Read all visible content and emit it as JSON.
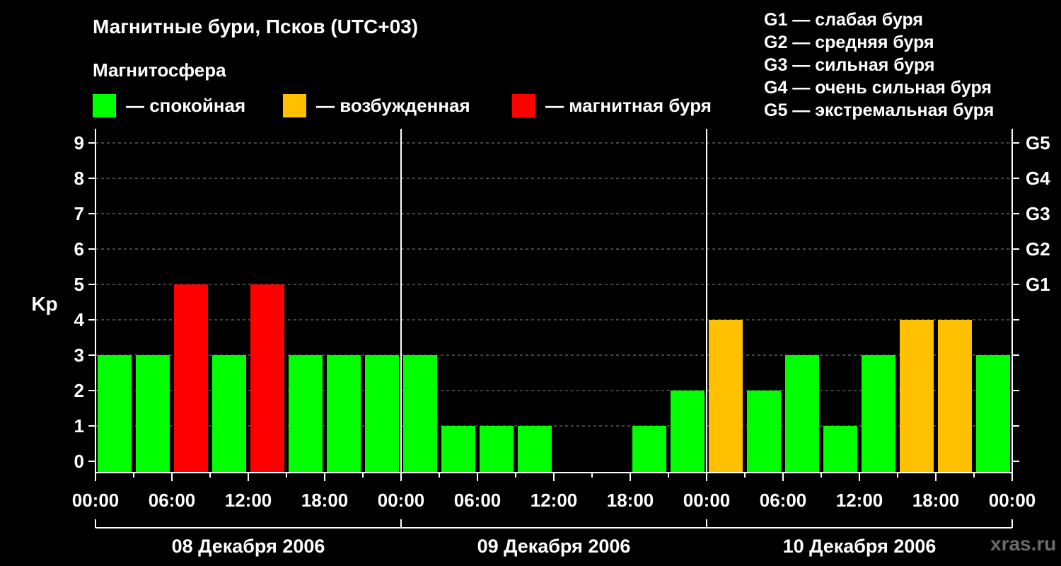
{
  "header": {
    "title": "Магнитные бури, Псков (UTC+03)",
    "subtitle": "Магнитосфера"
  },
  "legend": [
    {
      "label": "— спокойная",
      "color": "#00ff00"
    },
    {
      "label": "— возбужденная",
      "color": "#ffc000"
    },
    {
      "label": "— магнитная буря",
      "color": "#ff0000"
    }
  ],
  "g_scale": [
    "G1 — слабая буря",
    "G2 — средняя буря",
    "G3 — сильная буря",
    "G4 — очень сильная буря",
    "G5 — экстремальная буря"
  ],
  "watermark": "xras.ru",
  "chart_data": {
    "type": "bar",
    "ylabel": "Kp",
    "ylim": [
      0,
      9
    ],
    "yticks": [
      0,
      1,
      2,
      3,
      4,
      5,
      6,
      7,
      8,
      9
    ],
    "right_axis_labels": [
      {
        "kp": 5,
        "label": "G1"
      },
      {
        "kp": 6,
        "label": "G2"
      },
      {
        "kp": 7,
        "label": "G3"
      },
      {
        "kp": 8,
        "label": "G4"
      },
      {
        "kp": 9,
        "label": "G5"
      }
    ],
    "x_tick_labels": [
      "00:00",
      "06:00",
      "12:00",
      "18:00",
      "00:00",
      "06:00",
      "12:00",
      "18:00",
      "00:00",
      "06:00",
      "12:00",
      "18:00",
      "00:00"
    ],
    "days": [
      "08 Декабря 2006",
      "09 Декабря 2006",
      "10 Декабря 2006"
    ],
    "grid": "dashed horizontal",
    "values": [
      3,
      3,
      5,
      3,
      5,
      3,
      3,
      3,
      3,
      1,
      1,
      1,
      0,
      0,
      1,
      2,
      4,
      2,
      3,
      1,
      3,
      4,
      4,
      3
    ],
    "colors": {
      "quiet": "#00ff00",
      "active": "#ffc000",
      "storm": "#ff0000"
    }
  }
}
